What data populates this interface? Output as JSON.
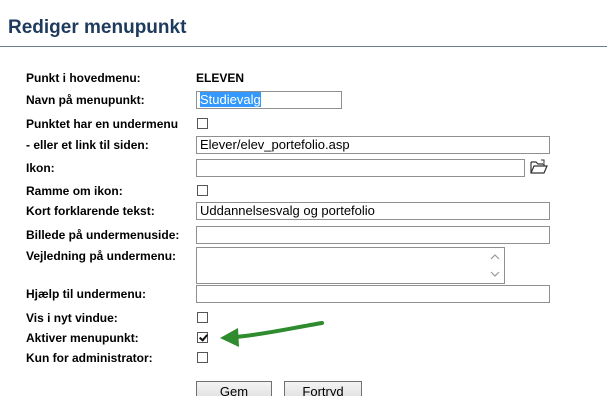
{
  "header": {
    "title": "Rediger menupunkt"
  },
  "form": {
    "main_menu_label": "Punkt i hovedmenu:",
    "main_menu_value": "ELEVEN",
    "name_label": "Navn på menupunkt:",
    "name_value": "Studievalg",
    "has_submenu_label": "Punktet har en undermenu",
    "has_submenu_checked": false,
    "link_label": "- eller et link til siden:",
    "link_value": "Elever/elev_portefolio.asp",
    "icon_label": "Ikon:",
    "icon_value": "",
    "icon_browse_icon": "folder-open-icon",
    "frame_icon_label": "Ramme om ikon:",
    "frame_icon_checked": false,
    "short_text_label": "Kort forklarende tekst:",
    "short_text_value": "Uddannelsesvalg og portefolio",
    "submenu_image_label": "Billede på undermenuside:",
    "submenu_image_value": "",
    "submenu_guide_label": "Vejledning på undermenu:",
    "submenu_guide_value": "",
    "submenu_help_label": "Hjælp til undermenu:",
    "submenu_help_value": "",
    "new_window_label": "Vis i nyt vindue:",
    "new_window_checked": false,
    "activate_label": "Aktiver menupunkt:",
    "activate_checked": true,
    "admin_only_label": "Kun for administrator:",
    "admin_only_checked": false
  },
  "buttons": {
    "save_label": "Gem",
    "cancel_label": "Fortryd"
  },
  "colors": {
    "title": "#1e3a5c",
    "selection": "#3399ff",
    "arrow": "#2e8b2e"
  }
}
